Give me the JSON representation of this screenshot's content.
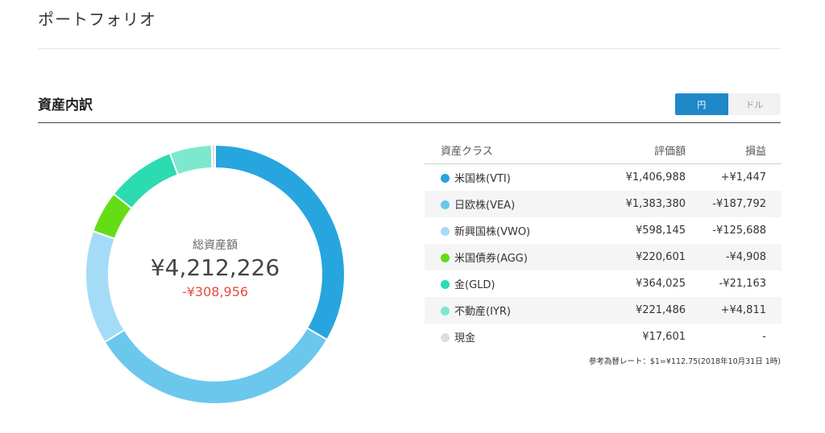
{
  "page_title": "ポートフォリオ",
  "section_title": "資産内訳",
  "currency_toggle": {
    "yen": "円",
    "dollar": "ドル",
    "selected": "yen"
  },
  "summary": {
    "label": "総資産額",
    "total": "¥4,212,226",
    "gain": "-¥308,956"
  },
  "table": {
    "headers": {
      "asset_class": "資産クラス",
      "value": "評価額",
      "gain": "損益"
    },
    "rows": [
      {
        "name": "米国株(VTI)",
        "value": "¥1,406,988",
        "gain": "+¥1,447",
        "color": "#27a5df",
        "amount": 1406988,
        "trend": "pos"
      },
      {
        "name": "日欧株(VEA)",
        "value": "¥1,383,380",
        "gain": "-¥187,792",
        "color": "#6bc7ec",
        "amount": 1383380,
        "trend": "neg"
      },
      {
        "name": "新興国株(VWO)",
        "value": "¥598,145",
        "gain": "-¥125,688",
        "color": "#a4dcf7",
        "amount": 598145,
        "trend": "neg"
      },
      {
        "name": "米国債券(AGG)",
        "value": "¥220,601",
        "gain": "-¥4,908",
        "color": "#64dd17",
        "amount": 220601,
        "trend": "neg"
      },
      {
        "name": "金(GLD)",
        "value": "¥364,025",
        "gain": "-¥21,163",
        "color": "#2ddbb0",
        "amount": 364025,
        "trend": "neg"
      },
      {
        "name": "不動産(IYR)",
        "value": "¥221,486",
        "gain": "+¥4,811",
        "color": "#7ee8cf",
        "amount": 221486,
        "trend": "pos"
      },
      {
        "name": "現金",
        "value": "¥17,601",
        "gain": "-",
        "color": "#dddddd",
        "amount": 17601,
        "trend": "neu"
      }
    ]
  },
  "fx_note": "参考為替レート：$1=¥112.75(2018年10月31日 1時)"
}
